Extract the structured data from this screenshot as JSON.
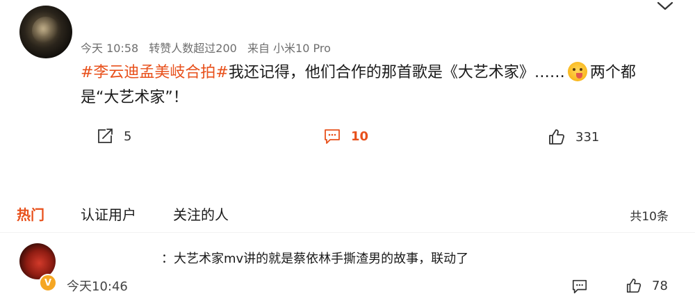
{
  "post": {
    "meta": {
      "time": "今天 10:58",
      "reposts": "转赞人数超过200",
      "source": "来自 小米10 Pro"
    },
    "hashtag": "#李云迪孟美岐合拍#",
    "text_before_emoji": "我还记得，他们合作的那首歌是《大艺术家》……",
    "text_after_emoji": "两个都是“大艺术家”！",
    "actions": {
      "repost_count": "5",
      "comment_count": "10",
      "like_count": "331"
    }
  },
  "tabs": [
    {
      "label": "热门"
    },
    {
      "label": "认证用户"
    },
    {
      "label": "关注的人"
    }
  ],
  "total_count": "共10条",
  "reply": {
    "text": "：大艺术家mv讲的就是蔡依林手撕渣男的故事，联动了",
    "time": "今天10:46",
    "badge": "V",
    "like_count": "78"
  },
  "icons": {
    "menu": "chevron-down-icon",
    "repost": "share-icon",
    "comment": "comment-icon",
    "like": "thumbs-up-icon",
    "emoji": "blushing-emoji-icon"
  },
  "colors": {
    "accent": "#e8501b",
    "badge": "#f5a623"
  }
}
